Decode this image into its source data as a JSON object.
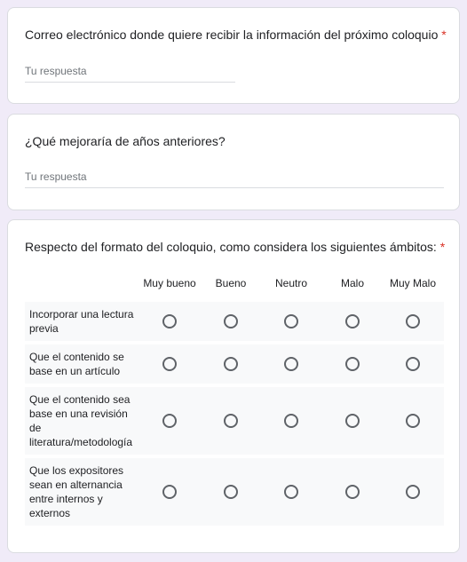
{
  "questions": [
    {
      "title": "Correo electrónico donde quiere recibir la información del próximo coloquio",
      "required_mark": "*",
      "placeholder": "Tu respuesta"
    },
    {
      "title": "¿Qué mejoraría de años anteriores?",
      "placeholder": "Tu respuesta"
    }
  ],
  "grid": {
    "title": "Respecto del formato del coloquio, como considera los siguientes ámbitos:",
    "required_mark": "*",
    "columns": [
      "Muy bueno",
      "Bueno",
      "Neutro",
      "Malo",
      "Muy Malo"
    ],
    "rows": [
      "Incorporar una lectura previa",
      "Que el contenido se base en un artículo",
      "Que el contenido sea base en una revisión de literatura/metodología",
      "Que los expositores sean en alternancia entre internos y externos"
    ]
  },
  "colors": {
    "page_background": "#f0ebf8",
    "required": "#d93025",
    "row_background": "#f8f9fa"
  }
}
